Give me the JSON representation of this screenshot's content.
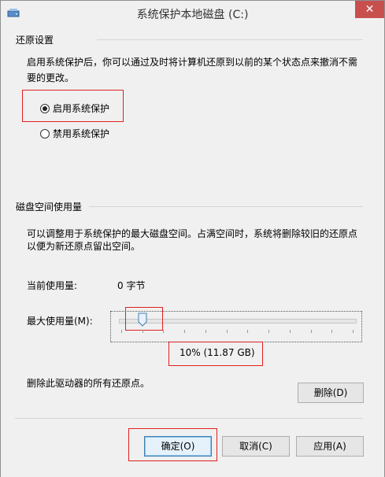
{
  "window": {
    "title": "系统保护本地磁盘 (C:)",
    "close_glyph": "✕",
    "accent_close": "#c7504f"
  },
  "restore": {
    "section_label": "还原设置",
    "description_line1": "启用系统保护后，你可以通过及时将计算机还原到以前的某个状态点来撤消不需",
    "description_line2": "要的更改。",
    "options": [
      {
        "label": "启用系统保护",
        "checked": true
      },
      {
        "label": "禁用系统保护",
        "checked": false
      }
    ]
  },
  "disk": {
    "section_label": "磁盘空间使用量",
    "description_line1": "可以调整用于系统保护的最大磁盘空间。占满空间时，系统将删除较旧的还原点",
    "description_line2": "以便为新还原点留出空间。",
    "current_usage_label": "当前使用量:",
    "current_usage_value": "0 字节",
    "max_usage_label": "最大使用量(M):",
    "max_usage_percent": 10,
    "max_usage_display": "10% (11.87 GB)"
  },
  "delete": {
    "description": "删除此驱动器的所有还原点。",
    "button_label": "删除(D)"
  },
  "footer": {
    "ok_label": "确定(O)",
    "cancel_label": "取消(C)",
    "apply_label": "应用(A)"
  },
  "colors": {
    "highlight": "#e02020",
    "default_button_border": "#3c7fb1"
  }
}
